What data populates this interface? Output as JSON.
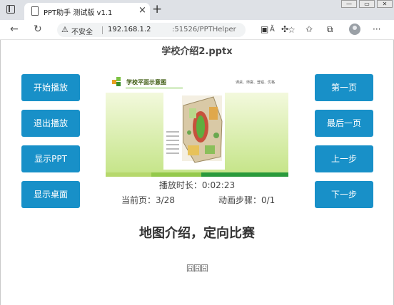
{
  "browser": {
    "tab_title": "PPT助手 测试版 v1.1",
    "tab_close": "×",
    "new_tab": "+",
    "minimize": "—",
    "maximize": "▭",
    "close": "✕",
    "insecure_label": "不安全",
    "url_host": "192.168.1.2",
    "url_path": ":51526/PPTHelper",
    "read_aloud": "Ă",
    "more": "···"
  },
  "page": {
    "file_name": "学校介绍2.pptx",
    "left_buttons": [
      "开始播放",
      "退出播放",
      "显示PPT",
      "显示桌面"
    ],
    "right_buttons": [
      "第一页",
      "最后一页",
      "上一步",
      "下一步"
    ],
    "duration": "播放时长：0:02:23",
    "current_page": "当前页：3/28",
    "animation_steps": "动画步骤：0/1",
    "slide_caption": "地图介绍，定向比赛",
    "notes_text": "囧囧囧"
  },
  "slide_preview": {
    "title": "学校平面示意图",
    "subtitle": "课桌、师宴、登铝、优格"
  },
  "colors": {
    "accent": "#1890c8",
    "slide_green": "#3aa23a",
    "slide_light": "#c6e58a"
  }
}
